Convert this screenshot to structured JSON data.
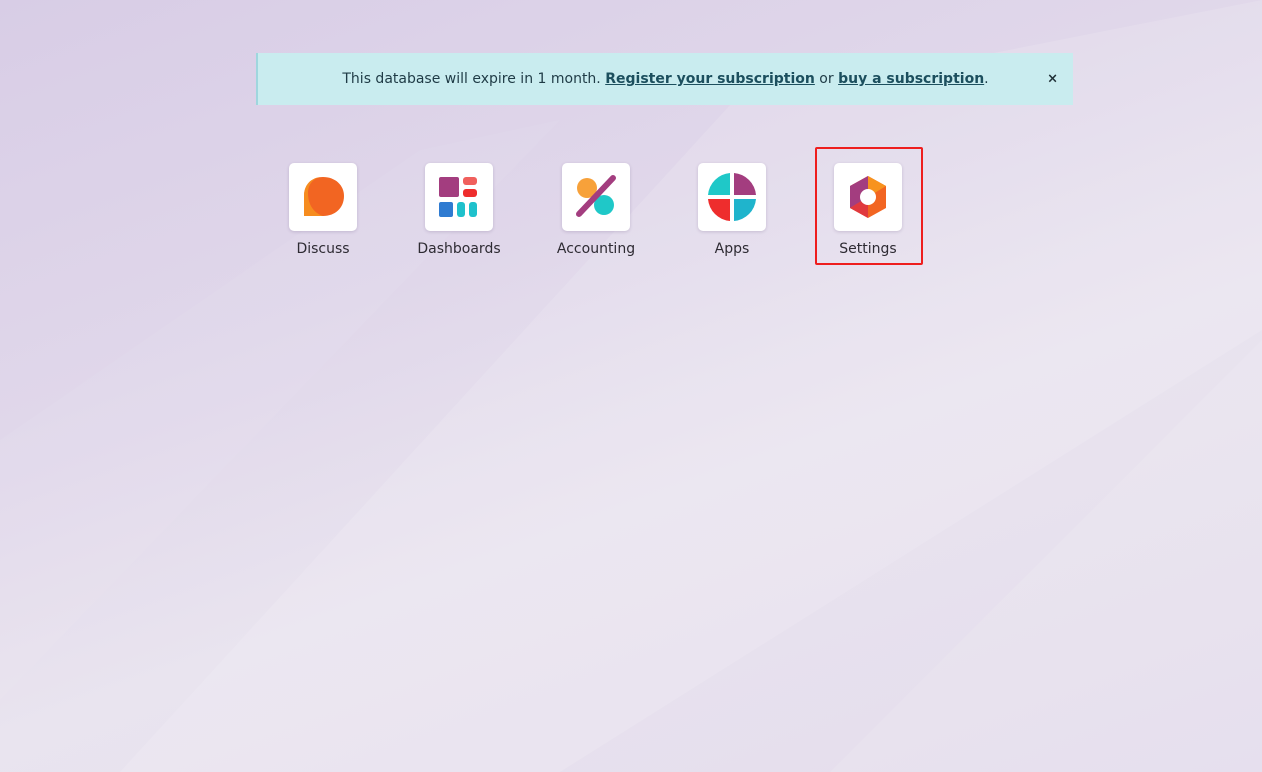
{
  "alert": {
    "text_before": "This database will expire in 1 month. ",
    "register_link": "Register your subscription",
    "text_middle": " or ",
    "buy_link": "buy a subscription",
    "text_after": ".",
    "close_label": "×",
    "background_color": "#c9ecef"
  },
  "apps": [
    {
      "label": "Discuss",
      "icon": "discuss-icon"
    },
    {
      "label": "Dashboards",
      "icon": "dashboards-icon"
    },
    {
      "label": "Accounting",
      "icon": "accounting-icon"
    },
    {
      "label": "Apps",
      "icon": "apps-icon"
    },
    {
      "label": "Settings",
      "icon": "settings-icon"
    }
  ],
  "highlighted_app": "Settings",
  "colors": {
    "background": "#ddd3e8",
    "highlight_border": "#ee1e1e",
    "tile_background": "#ffffff"
  }
}
